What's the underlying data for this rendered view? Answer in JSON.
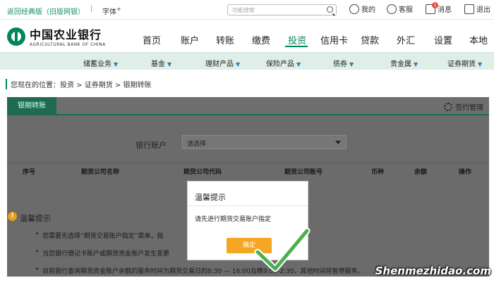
{
  "util": {
    "back_link": "返回经典版（旧版网银）",
    "separator": "|",
    "font_label": "字体",
    "font_sup": "+",
    "search_placeholder": "功能搜索",
    "items": [
      {
        "label": "我的",
        "icon": "user-icon"
      },
      {
        "label": "客服",
        "icon": "headset-icon"
      },
      {
        "label": "消息",
        "icon": "mail-icon",
        "badge": "1"
      },
      {
        "label": "退出",
        "icon": "logout-icon"
      }
    ]
  },
  "logo": {
    "cn": "中国农业银行",
    "en": "AGRICULTURAL BANK OF CHINA"
  },
  "main_nav": [
    "首页",
    "账户",
    "转账",
    "缴费",
    "投资",
    "信用卡",
    "贷款",
    "外汇",
    "设置",
    "本地"
  ],
  "main_nav_active": "投资",
  "sub_nav": [
    "储蓄业务",
    "基金",
    "理财产品",
    "保险产品",
    "债券",
    "贵金属",
    "证券期货"
  ],
  "breadcrumb": "您现在的位置：投资 > 证券期货 > 银期转账",
  "panel": {
    "tab": "银期转账",
    "sign_label": "签约管理",
    "account_label": "银行账户",
    "select_value": "请选择",
    "columns": [
      "序号",
      "期货公司名称",
      "期货公司代码",
      "期货公司账号",
      "币种",
      "余额",
      "操作"
    ],
    "tip_title": "温馨提示",
    "tips": [
      "您需要先选择“期货交易账户指定”菜单，指",
      "当您银行借记卡账户或期货资金账户发生变更",
      "目前我行查询期货资金账户余额的服务时间为期货交易日的8:30 — 16:00及晚9:00-2:30，其他时间将暂停服务。"
    ]
  },
  "modal": {
    "title": "温馨提示",
    "message": "请先进行期货交易账户指定",
    "ok_label": "确定"
  },
  "watermark": "Shenmezhidao.com",
  "colors": {
    "brand": "#00875a",
    "ok_button": "#f5a623",
    "overlay": "#6b6b6b"
  }
}
